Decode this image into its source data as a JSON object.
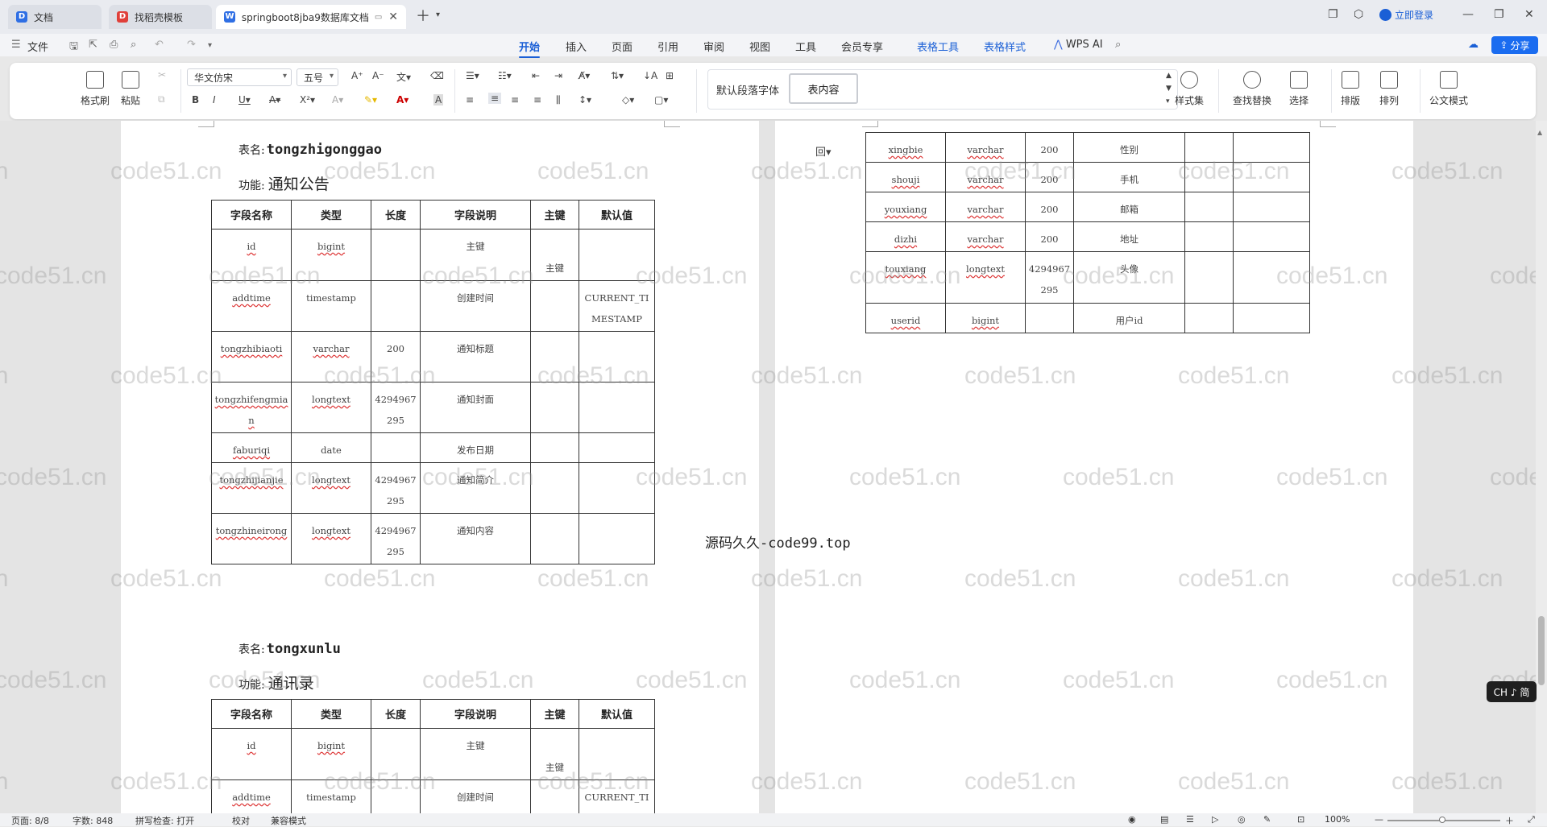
{
  "tabs": [
    {
      "label": "文档",
      "icon": "docs-icon",
      "color": "#2f6fe4"
    },
    {
      "label": "找稻壳模板",
      "icon": "daoke-icon",
      "color": "#e0403a"
    },
    {
      "label": "springboot8jba9数据库文档",
      "icon": "wps-writer-icon",
      "color": "#2f6fe4"
    }
  ],
  "titlebar": {
    "login_label": "立即登录"
  },
  "menu": {
    "file_label": "文件",
    "items": [
      "开始",
      "插入",
      "页面",
      "引用",
      "审阅",
      "视图",
      "工具",
      "会员专享",
      "表格工具",
      "表格样式"
    ],
    "active": "开始",
    "ai_label": "WPS AI",
    "share_label": "分享"
  },
  "ribbon": {
    "format_painter": "格式刷",
    "paste": "粘贴",
    "font_name": "华文仿宋",
    "font_size": "五号",
    "style_default": "默认段落字体",
    "style_current": "表内容",
    "style_set": "样式集",
    "find_replace": "查找替换",
    "select": "选择",
    "typeset": "排版",
    "arrange": "排列",
    "official_mode": "公文模式"
  },
  "columns": [
    "字段名称",
    "类型",
    "长度",
    "字段说明",
    "主键",
    "默认值"
  ],
  "table1": {
    "name_label": "表名:",
    "name": "tongzhigonggao",
    "func_label": "功能:",
    "func": "通知公告",
    "rows": [
      [
        "id",
        "bigint",
        "",
        "主键",
        "主键",
        ""
      ],
      [
        "addtime",
        "timestamp",
        "",
        "创建时间",
        "",
        "CURRENT_TIMESTAMP"
      ],
      [
        "tongzhibiaoti",
        "varchar",
        "200",
        "通知标题",
        "",
        ""
      ],
      [
        "tongzhifengmian",
        "longtext",
        "4294967295",
        "通知封面",
        "",
        ""
      ],
      [
        "faburiqi",
        "date",
        "",
        "发布日期",
        "",
        ""
      ],
      [
        "tongzhijianjie",
        "longtext",
        "4294967295",
        "通知简介",
        "",
        ""
      ],
      [
        "tongzhineirong",
        "longtext",
        "4294967295",
        "通知内容",
        "",
        ""
      ]
    ]
  },
  "table2": {
    "name_label": "表名:",
    "name": "tongxunlu",
    "func_label": "功能:",
    "func": "通讯录",
    "rows": [
      [
        "id",
        "bigint",
        "",
        "主键",
        "主键",
        ""
      ],
      [
        "addtime",
        "timestamp",
        "",
        "创建时间",
        "",
        "CURRENT_TIM"
      ]
    ]
  },
  "table_right": {
    "rows": [
      [
        "xingbie",
        "varchar",
        "200",
        "性别",
        "",
        ""
      ],
      [
        "shouji",
        "varchar",
        "200",
        "手机",
        "",
        ""
      ],
      [
        "youxiang",
        "varchar",
        "200",
        "邮箱",
        "",
        ""
      ],
      [
        "dizhi",
        "varchar",
        "200",
        "地址",
        "",
        ""
      ],
      [
        "touxiang",
        "longtext",
        "4294967295",
        "头像",
        "",
        ""
      ],
      [
        "userid",
        "bigint",
        "",
        "用户id",
        "",
        ""
      ]
    ]
  },
  "overlay_text": "源码久久-code99.top",
  "watermark": "code51.cn",
  "ime_label": "CH ♪ 简",
  "status": {
    "page": "页面: 8/8",
    "words": "字数: 848",
    "spell": "拼写检查: 打开",
    "proof": "校对",
    "compat": "兼容模式",
    "zoom": "100%"
  }
}
